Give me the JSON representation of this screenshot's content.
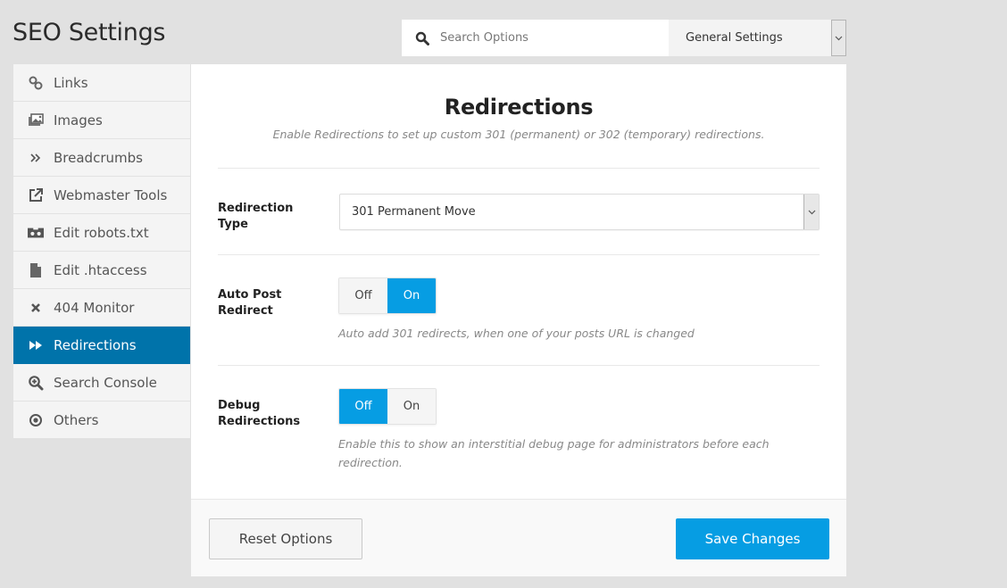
{
  "page": {
    "title": "SEO Settings"
  },
  "search": {
    "placeholder": "Search Options",
    "value": ""
  },
  "settings_select": {
    "selected": "General Settings"
  },
  "sidebar": {
    "items": [
      {
        "label": "Links",
        "icon": "link-icon",
        "active": false
      },
      {
        "label": "Images",
        "icon": "images-icon",
        "active": false
      },
      {
        "label": "Breadcrumbs",
        "icon": "double-chevron-right-icon",
        "active": false
      },
      {
        "label": "Webmaster Tools",
        "icon": "external-link-icon",
        "active": false
      },
      {
        "label": "Edit robots.txt",
        "icon": "robot-icon",
        "active": false
      },
      {
        "label": "Edit .htaccess",
        "icon": "file-icon",
        "active": false
      },
      {
        "label": "404 Monitor",
        "icon": "close-icon",
        "active": false
      },
      {
        "label": "Redirections",
        "icon": "fast-forward-icon",
        "active": true
      },
      {
        "label": "Search Console",
        "icon": "zoom-in-icon",
        "active": false
      },
      {
        "label": "Others",
        "icon": "dot-circle-icon",
        "active": false
      }
    ]
  },
  "panel": {
    "title": "Redirections",
    "subtitle": "Enable Redirections to set up custom 301 (permanent) or 302 (temporary) redirections.",
    "fields": {
      "redirection_type": {
        "label": "Redirection Type",
        "selected": "301 Permanent Move"
      },
      "auto_post_redirect": {
        "label": "Auto Post Redirect",
        "off_label": "Off",
        "on_label": "On",
        "value": "On",
        "description": "Auto add 301 redirects, when one of your posts URL is changed"
      },
      "debug_redirections": {
        "label": "Debug Redirections",
        "off_label": "Off",
        "on_label": "On",
        "value": "Off",
        "description": "Enable this to show an interstitial debug page for administrators before each redirection."
      }
    }
  },
  "footer": {
    "reset_label": "Reset Options",
    "save_label": "Save Changes"
  },
  "colors": {
    "accent": "#069de3",
    "active_nav": "#0073aa",
    "background": "#e1e1e1"
  }
}
